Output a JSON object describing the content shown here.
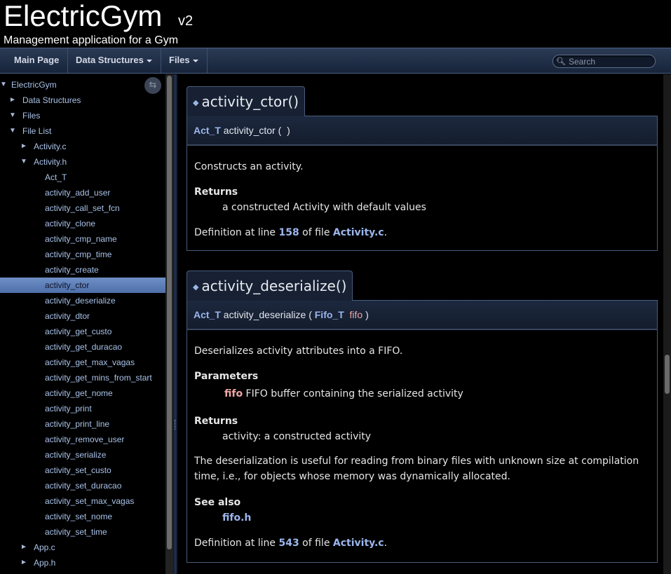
{
  "header": {
    "project_name": "ElectricGym",
    "project_number": "v2",
    "project_brief": "Management application for a Gym"
  },
  "menu": {
    "main_page": "Main Page",
    "data_structures": "Data Structures",
    "files": "Files",
    "search_placeholder": "Search"
  },
  "sidebar": {
    "sync_icon": "sync-arrows-icon",
    "items": [
      {
        "label": "ElectricGym",
        "arrow": "▼",
        "level": 0
      },
      {
        "label": "Data Structures",
        "arrow": "►",
        "level": 1
      },
      {
        "label": "Files",
        "arrow": "▼",
        "level": 1
      },
      {
        "label": "File List",
        "arrow": "▼",
        "level": 2
      },
      {
        "label": "Activity.c",
        "arrow": "►",
        "level": 3
      },
      {
        "label": "Activity.h",
        "arrow": "▼",
        "level": 3
      },
      {
        "label": "Act_T",
        "arrow": "",
        "level": 4
      },
      {
        "label": "activity_add_user",
        "arrow": "",
        "level": 4
      },
      {
        "label": "activity_call_set_fcn",
        "arrow": "",
        "level": 4
      },
      {
        "label": "activity_clone",
        "arrow": "",
        "level": 4
      },
      {
        "label": "activity_cmp_name",
        "arrow": "",
        "level": 4
      },
      {
        "label": "activity_cmp_time",
        "arrow": "",
        "level": 4
      },
      {
        "label": "activity_create",
        "arrow": "",
        "level": 4
      },
      {
        "label": "activity_ctor",
        "arrow": "",
        "level": 4,
        "selected": true
      },
      {
        "label": "activity_deserialize",
        "arrow": "",
        "level": 4
      },
      {
        "label": "activity_dtor",
        "arrow": "",
        "level": 4
      },
      {
        "label": "activity_get_custo",
        "arrow": "",
        "level": 4
      },
      {
        "label": "activity_get_duracao",
        "arrow": "",
        "level": 4
      },
      {
        "label": "activity_get_max_vagas",
        "arrow": "",
        "level": 4
      },
      {
        "label": "activity_get_mins_from_start",
        "arrow": "",
        "level": 4
      },
      {
        "label": "activity_get_nome",
        "arrow": "",
        "level": 4
      },
      {
        "label": "activity_print",
        "arrow": "",
        "level": 4
      },
      {
        "label": "activity_print_line",
        "arrow": "",
        "level": 4
      },
      {
        "label": "activity_remove_user",
        "arrow": "",
        "level": 4
      },
      {
        "label": "activity_serialize",
        "arrow": "",
        "level": 4
      },
      {
        "label": "activity_set_custo",
        "arrow": "",
        "level": 4
      },
      {
        "label": "activity_set_duracao",
        "arrow": "",
        "level": 4
      },
      {
        "label": "activity_set_max_vagas",
        "arrow": "",
        "level": 4
      },
      {
        "label": "activity_set_nome",
        "arrow": "",
        "level": 4
      },
      {
        "label": "activity_set_time",
        "arrow": "",
        "level": 4
      },
      {
        "label": "App.c",
        "arrow": "►",
        "level": 3
      },
      {
        "label": "App.h",
        "arrow": "►",
        "level": 3
      }
    ]
  },
  "members": {
    "ctor": {
      "title": "activity_ctor()",
      "ret_type": "Act_T",
      "name": "activity_ctor",
      "open_paren": "(",
      "close_paren": ")",
      "brief": "Constructs an activity.",
      "returns_heading": "Returns",
      "returns_text": "a constructed Activity with default values",
      "def_prefix": "Definition at line",
      "def_line": "158",
      "def_mid": "of file",
      "def_file": "Activity.c",
      "def_suffix": "."
    },
    "deserialize": {
      "title": "activity_deserialize()",
      "ret_type": "Act_T",
      "name": "activity_deserialize",
      "open_paren": "(",
      "param_type": "Fifo_T",
      "param_name": "fifo",
      "close_paren": ")",
      "brief": "Deserializes activity attributes into a FIFO.",
      "params_heading": "Parameters",
      "param_doc_name": "fifo",
      "param_doc_text": "FIFO buffer containing the serialized activity",
      "returns_heading": "Returns",
      "returns_text": "activity: a constructed activity",
      "details": "The deserialization is useful for reading from binary files with unknown size at compilation time, i.e., for objects whose memory was dynamically allocated.",
      "see_also_heading": "See also",
      "see_also_link": "fifo.h",
      "def_prefix": "Definition at line",
      "def_line": "543",
      "def_mid": "of file",
      "def_file": "Activity.c",
      "def_suffix": "."
    }
  }
}
